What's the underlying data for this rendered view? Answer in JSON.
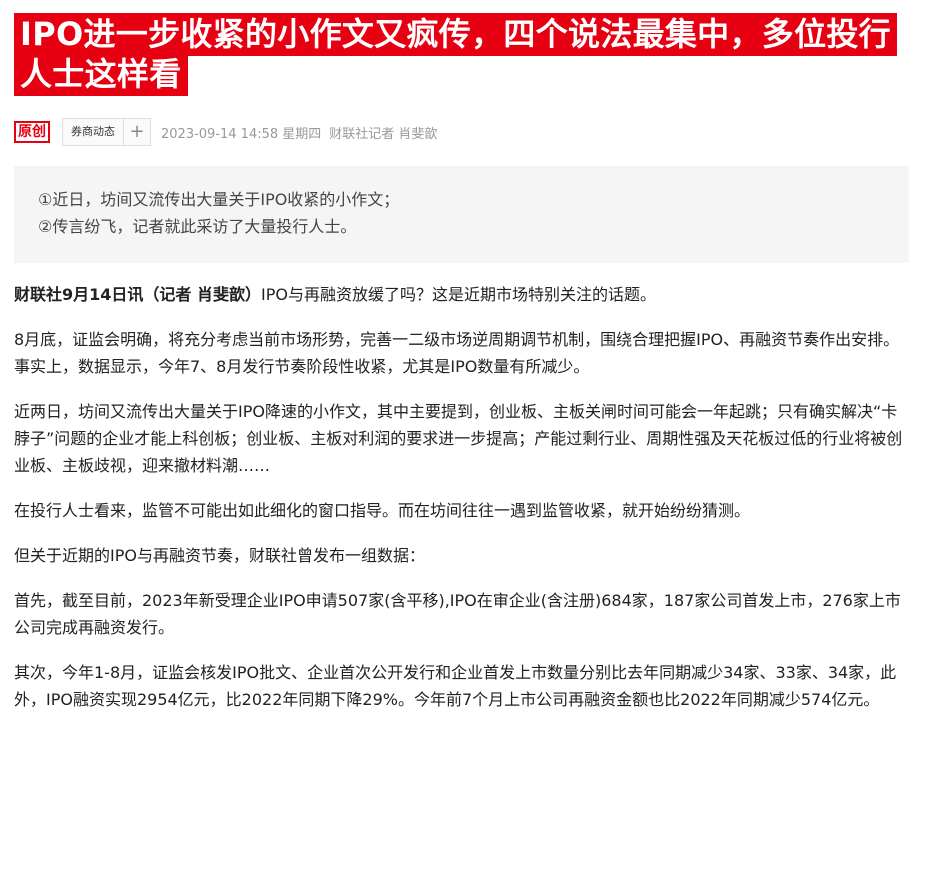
{
  "article": {
    "headline": "IPO进一步收紧的小作文又疯传，四个说法最集中，多位投行人士这样看",
    "original_badge": "原创",
    "tag": "券商动态",
    "tag_action_icon": "plus-icon",
    "datetime": "2023-09-14 14:58 星期四",
    "author": "财联社记者 肖斐歆"
  },
  "summary": {
    "points": [
      "①近日，坊间又流传出大量关于IPO收紧的小作文；",
      "②传言纷飞，记者就此采访了大量投行人士。"
    ]
  },
  "body": {
    "lead_dateline": "财联社9月14日讯（记者 肖斐歆）",
    "lead_text": "IPO与再融资放缓了吗？这是近期市场特别关注的话题。",
    "paragraphs": [
      "8月底，证监会明确，将充分考虑当前市场形势，完善一二级市场逆周期调节机制，围绕合理把握IPO、再融资节奏作出安排。事实上，数据显示，今年7、8月发行节奏阶段性收紧，尤其是IPO数量有所减少。",
      "近两日，坊间又流传出大量关于IPO降速的小作文，其中主要提到，创业板、主板关闸时间可能会一年起跳；只有确实解决“卡脖子”问题的企业才能上科创板；创业板、主板对利润的要求进一步提高；产能过剩行业、周期性强及天花板过低的行业将被创业板、主板歧视，迎来撤材料潮……",
      "在投行人士看来，监管不可能出如此细化的窗口指导。而在坊间往往一遇到监管收紧，就开始纷纷猜测。",
      "但关于近期的IPO与再融资节奏，财联社曾发布一组数据：",
      "首先，截至目前，2023年新受理企业IPO申请507家(含平移),IPO在审企业(含注册)684家，187家公司首发上市，276家上市公司完成再融资发行。",
      "其次，今年1-8月，证监会核发IPO批文、企业首次公开发行和企业首发上市数量分别比去年同期减少34家、33家、34家，此外，IPO融资实现2954亿元，比2022年同期下降29%。今年前7个月上市公司再融资金额也比2022年同期减少574亿元。"
    ]
  },
  "colors": {
    "brand_red": "#e60012",
    "meta_gray": "#999999",
    "summary_bg": "#f5f5f5"
  }
}
